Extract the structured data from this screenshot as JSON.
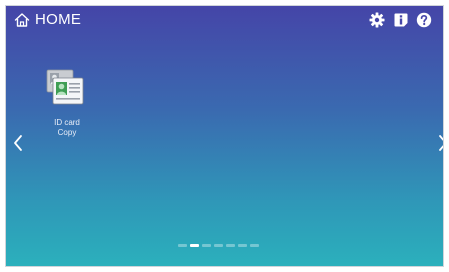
{
  "header": {
    "title": "HOME",
    "home_icon": "home-icon",
    "settings_icon": "gear-icon",
    "info_icon": "info-icon",
    "help_icon": "help-icon"
  },
  "apps": [
    {
      "label_line1": "ID card",
      "label_line2": "Copy",
      "icon": "id-card-copy-icon"
    }
  ],
  "navigation": {
    "previous_icon": "chevron-left-icon",
    "next_icon": "chevron-right-icon"
  },
  "pager": {
    "page_count": 7,
    "current_page": 2
  },
  "colors": {
    "gradient_top": "#4545a8",
    "gradient_bottom": "#2bb0bc",
    "text": "#ffffff"
  }
}
